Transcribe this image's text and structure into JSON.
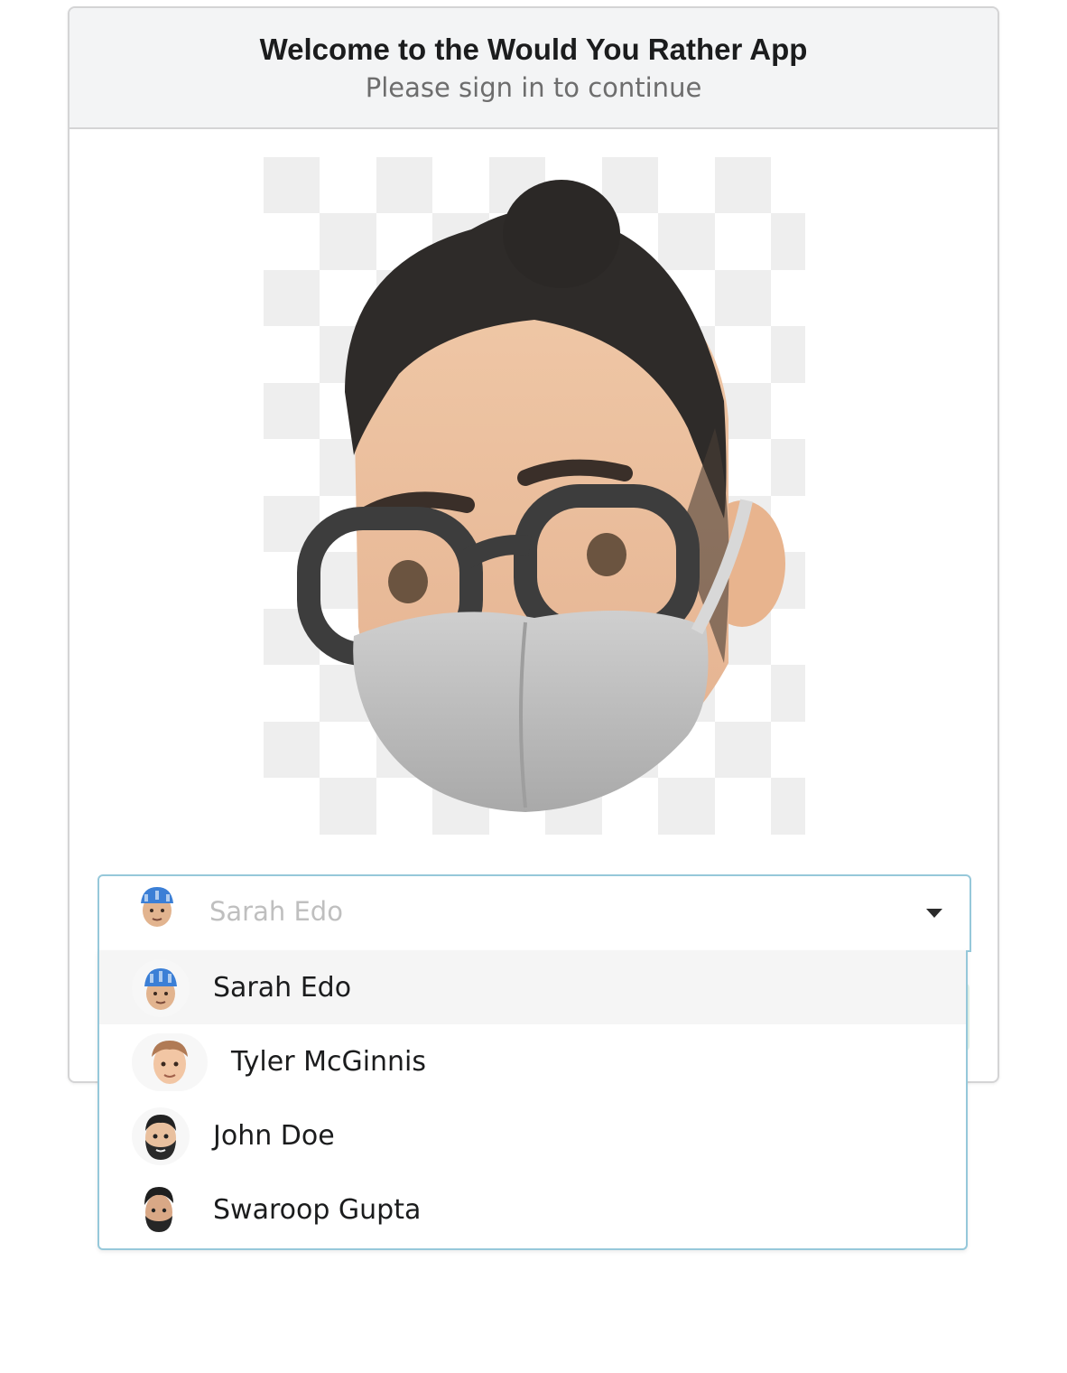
{
  "card": {
    "title": "Welcome to the Would You Rather App",
    "subtitle": "Please sign in to continue"
  },
  "hero": {
    "icon": "memoji-avatar-with-glasses-and-mask-icon"
  },
  "dropdown": {
    "selected_text": "Sarah Edo",
    "selected_icon": "avatar-sarah-icon",
    "caret_icon": "caret-down-icon",
    "options": [
      {
        "label": "Sarah Edo",
        "icon": "avatar-sarah-icon",
        "selected": true
      },
      {
        "label": "Tyler McGinnis",
        "icon": "avatar-tyler-icon",
        "selected": false
      },
      {
        "label": "John Doe",
        "icon": "avatar-john-icon",
        "selected": false
      },
      {
        "label": "Swaroop Gupta",
        "icon": "avatar-swaroop-icon",
        "selected": false
      }
    ]
  },
  "colors": {
    "focus_border": "#96c8da",
    "header_bg": "#f3f4f5",
    "selected_item_bg": "#f5f5f5",
    "placeholder_text": "#bfbfbf"
  }
}
